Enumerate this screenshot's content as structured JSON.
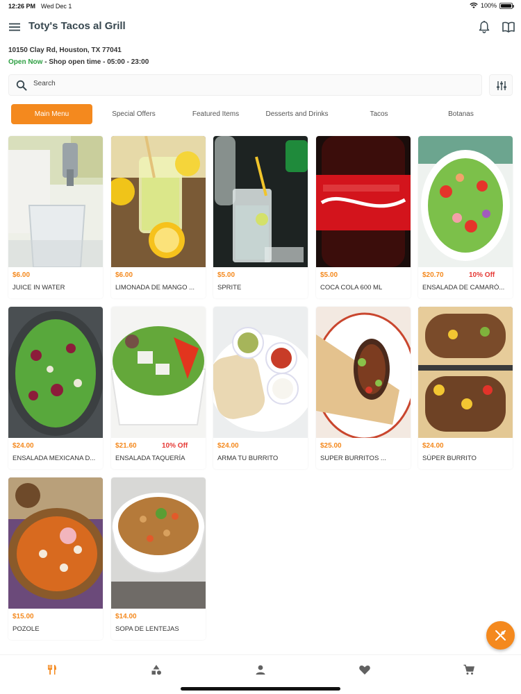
{
  "status_bar": {
    "time": "12:26 PM",
    "date": "Wed Dec 1",
    "battery": "100%"
  },
  "header": {
    "title": "Toty's Tacos al Grill"
  },
  "store": {
    "address": "10150 Clay Rd, Houston, TX 77041",
    "open_status": "Open Now",
    "hours_text": " - Shop open time - 05:00 - 23:00"
  },
  "search": {
    "placeholder": "Search"
  },
  "tabs": [
    {
      "label": "Main Menu",
      "active": true
    },
    {
      "label": "Special Offers"
    },
    {
      "label": "Featured Items"
    },
    {
      "label": "Desserts and Drinks"
    },
    {
      "label": "Tacos"
    },
    {
      "label": "Botanas"
    }
  ],
  "products": [
    {
      "price": "$6.00",
      "name": "JUICE IN WATER",
      "discount": ""
    },
    {
      "price": "$6.00",
      "name": "LIMONADA DE MANGO ...",
      "discount": ""
    },
    {
      "price": "$5.00",
      "name": "SPRITE",
      "discount": ""
    },
    {
      "price": "$5.00",
      "name": "COCA COLA 600 ML",
      "discount": ""
    },
    {
      "price": "$20.70",
      "name": "ENSALADA DE CAMARÓ...",
      "discount": "10% Off"
    },
    {
      "price": "$24.00",
      "name": "ENSALADA MEXICANA D...",
      "discount": ""
    },
    {
      "price": "$21.60",
      "name": "ENSALADA TAQUERÍA",
      "discount": "10% Off"
    },
    {
      "price": "$24.00",
      "name": "ARMA TU BURRITO",
      "discount": ""
    },
    {
      "price": "$25.00",
      "name": "SUPER BURRITOS ...",
      "discount": ""
    },
    {
      "price": "$24.00",
      "name": "SÚPER BURRITO",
      "discount": ""
    },
    {
      "price": "$15.00",
      "name": "POZOLE",
      "discount": ""
    },
    {
      "price": "$14.00",
      "name": "SOPA DE LENTEJAS",
      "discount": ""
    }
  ],
  "colors": {
    "accent": "#f4891e",
    "open_green": "#2ea043",
    "discount_red": "#e53935",
    "title": "#37474f"
  },
  "icons": {
    "menu": "menu-icon",
    "bell": "bell-icon",
    "book": "book-icon",
    "search": "search-icon",
    "filter": "filter-sliders-icon",
    "fab": "utensils-icon",
    "nav": [
      "utensils-icon",
      "categories-icon",
      "user-icon",
      "heart-icon",
      "cart-icon"
    ]
  }
}
